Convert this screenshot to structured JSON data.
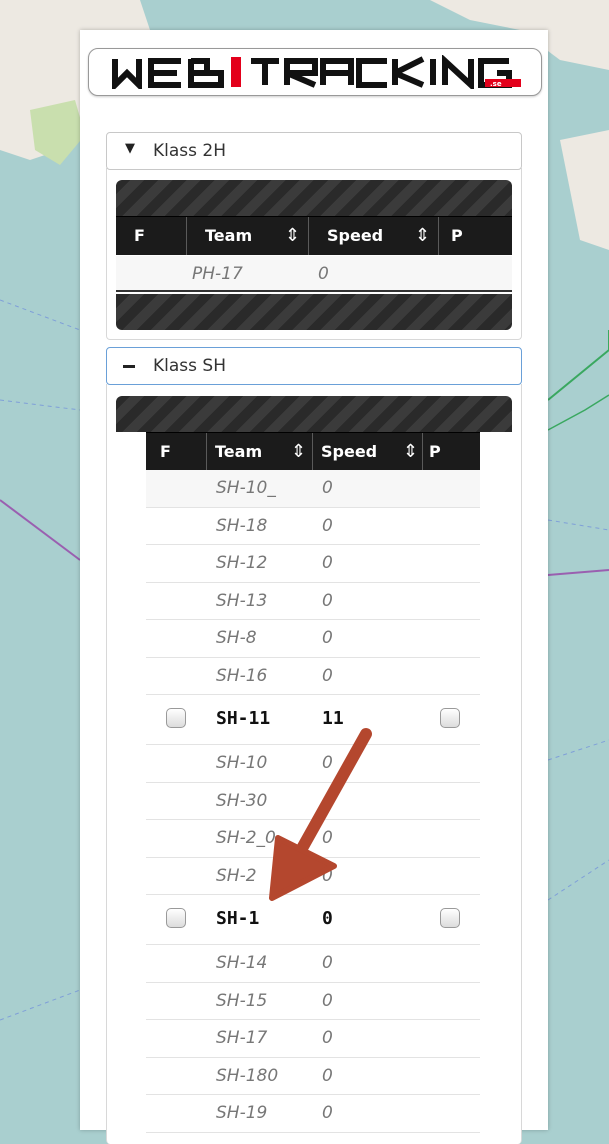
{
  "app": {
    "logo_text": "WEBTRACKING.se"
  },
  "colors": {
    "panel_bg": "#ffffff",
    "table_header_bg": "#1b1b1b",
    "accent_border": "#6aa0d8",
    "logo_red": "#e3001b",
    "arrow": "#b4472e"
  },
  "class_2h": {
    "title": "Klass 2H",
    "expanded": false,
    "columns": {
      "f": "F",
      "team": "Team",
      "speed": "Speed",
      "p": "P"
    },
    "rows": [
      {
        "team": "PH-17",
        "speed": "0"
      }
    ]
  },
  "class_sh": {
    "title": "Klass SH",
    "expanded": true,
    "columns": {
      "f": "F",
      "team": "Team",
      "speed": "Speed",
      "p": "P"
    },
    "rows": [
      {
        "team": "SH-10_",
        "speed": "0",
        "active": false
      },
      {
        "team": "SH-18",
        "speed": "0",
        "active": false
      },
      {
        "team": "SH-12",
        "speed": "0",
        "active": false
      },
      {
        "team": "SH-13",
        "speed": "0",
        "active": false
      },
      {
        "team": "SH-8",
        "speed": "0",
        "active": false
      },
      {
        "team": "SH-16",
        "speed": "0",
        "active": false
      },
      {
        "team": "SH-11",
        "speed": "11",
        "active": true
      },
      {
        "team": "SH-10",
        "speed": "0",
        "active": false
      },
      {
        "team": "SH-30",
        "speed": "",
        "active": false
      },
      {
        "team": "SH-2_0",
        "speed": "0",
        "active": false
      },
      {
        "team": "SH-2",
        "speed": "0",
        "active": false
      },
      {
        "team": "SH-1",
        "speed": "0",
        "active": true
      },
      {
        "team": "SH-14",
        "speed": "0",
        "active": false
      },
      {
        "team": "SH-15",
        "speed": "0",
        "active": false
      },
      {
        "team": "SH-17",
        "speed": "0",
        "active": false
      },
      {
        "team": "SH-180",
        "speed": "0",
        "active": false
      },
      {
        "team": "SH-19",
        "speed": "0",
        "active": false
      }
    ]
  },
  "icons": {
    "collapsed": "triangle-down-icon",
    "expanded": "minus-icon",
    "sort": "sort-updown-icon",
    "annotation": "red-arrow-icon"
  }
}
